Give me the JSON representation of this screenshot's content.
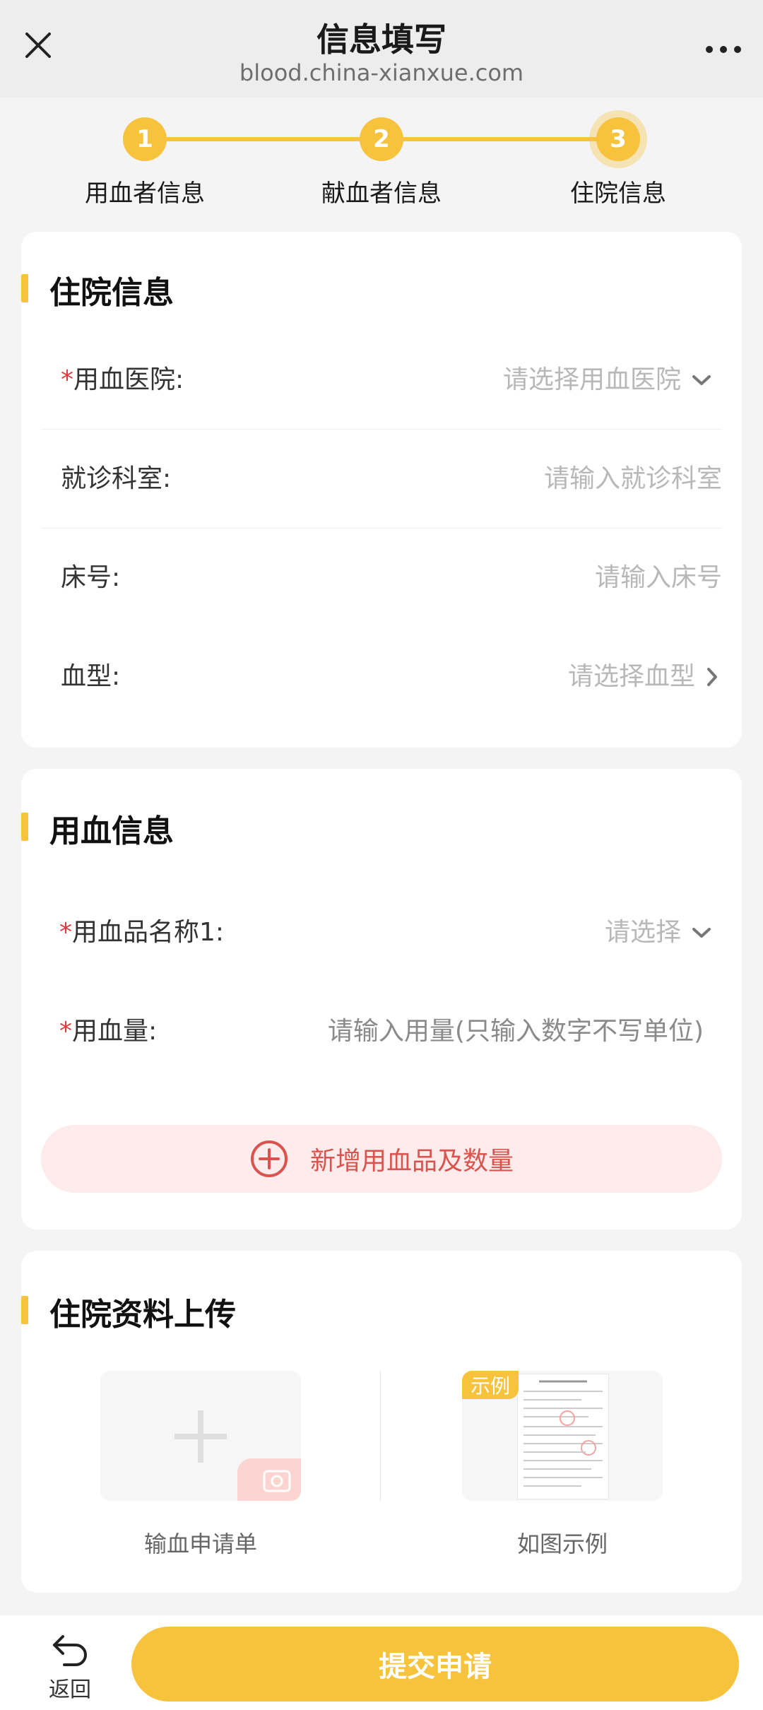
{
  "header": {
    "title": "信息填写",
    "url": "blood.china-xianxue.com"
  },
  "stepper": {
    "steps": [
      {
        "number": "1",
        "label": "用血者信息"
      },
      {
        "number": "2",
        "label": "献血者信息"
      },
      {
        "number": "3",
        "label": "住院信息"
      }
    ],
    "accent": "#f7c23c"
  },
  "hospital_section": {
    "title": "住院信息",
    "fields": [
      {
        "required": "*",
        "label": "用血医院:",
        "placeholder": "请选择用血医院"
      },
      {
        "required": "",
        "label": "就诊科室:",
        "placeholder": "请输入就诊科室"
      },
      {
        "required": "",
        "label": "床号:",
        "placeholder": "请输入床号"
      },
      {
        "required": "",
        "label": "血型:",
        "placeholder": "请选择血型"
      }
    ]
  },
  "blood_section": {
    "title": "用血信息",
    "fields": [
      {
        "required": "*",
        "label": "用血品名称1:",
        "placeholder": "请选择"
      },
      {
        "required": "*",
        "label": "用血量:",
        "placeholder": "请输入用量(只输入数字不写单位)"
      }
    ],
    "add_button": "新增用血品及数量"
  },
  "upload_section": {
    "title": "住院资料上传",
    "slots": [
      {
        "label": "输血申请单"
      },
      {
        "label": "如图示例",
        "tag": "示例"
      }
    ]
  },
  "footer": {
    "back_label": "返回",
    "submit_label": "提交申请"
  }
}
